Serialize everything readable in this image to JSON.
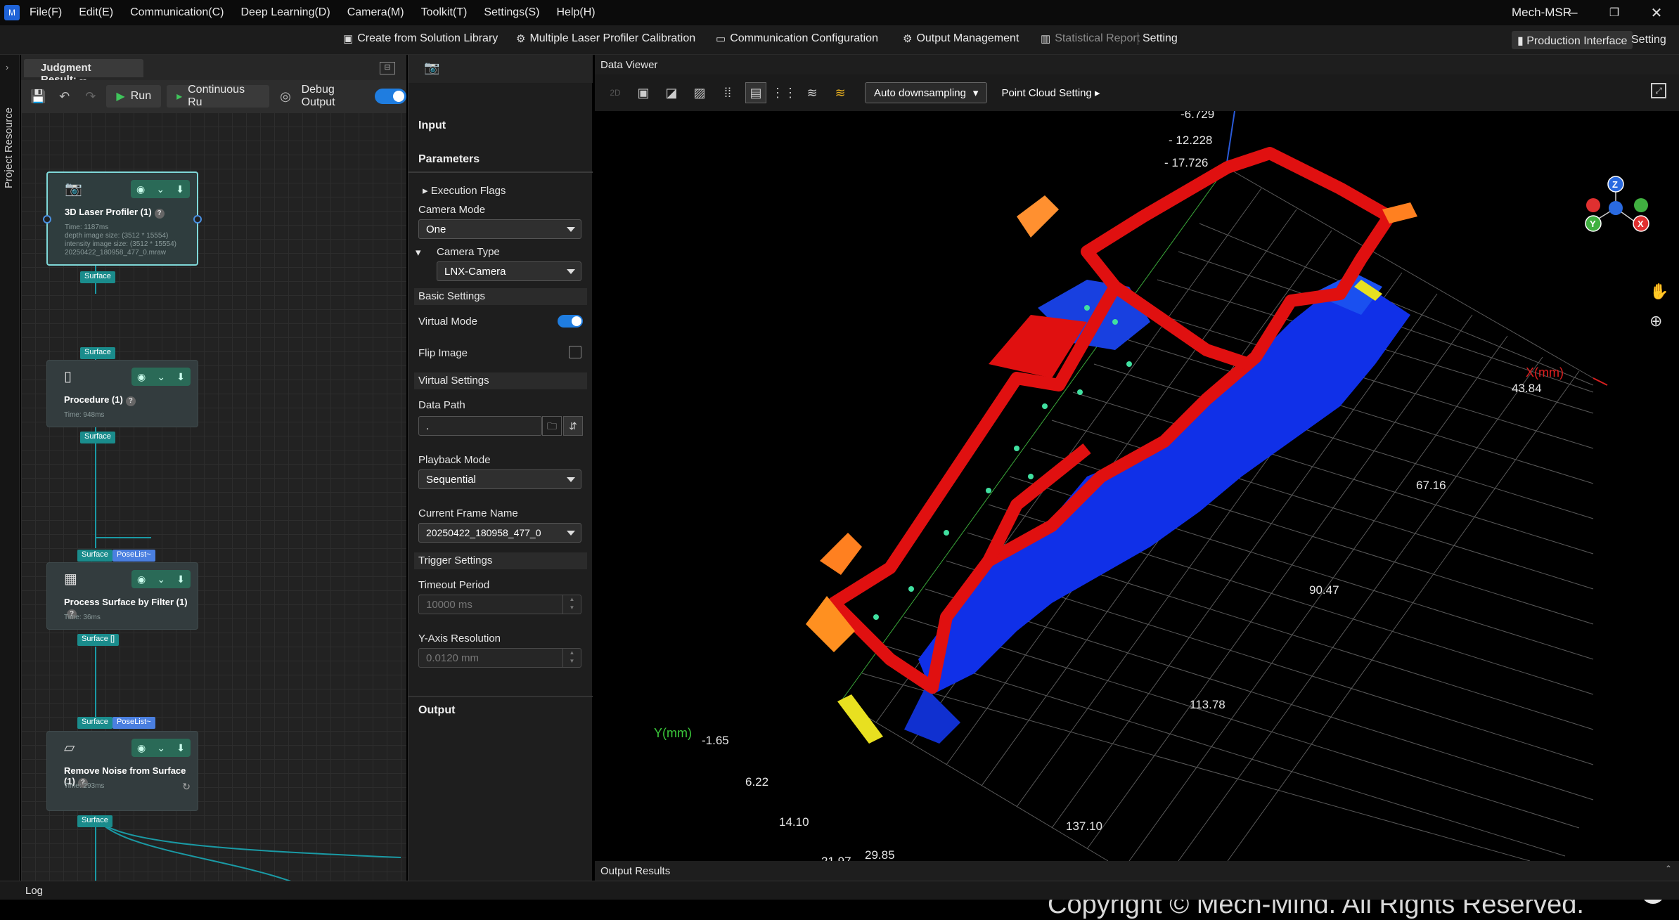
{
  "menubar": {
    "items": [
      "File(F)",
      "Edit(E)",
      "Communication(C)",
      "Deep Learning(D)",
      "Camera(M)",
      "Toolkit(T)",
      "Settings(S)",
      "Help(H)"
    ],
    "app_title": "Mech-MSR"
  },
  "toolbar": {
    "create_solution": "Create from Solution Library",
    "laser_calibration": "Multiple Laser Profiler Calibration",
    "communication_config": "Communication Configuration",
    "output_management": "Output Management",
    "statistical_report": "Statistical Report",
    "setting": "Setting",
    "production_interface": "Production Interface",
    "setting_right": "Setting"
  },
  "sidebar": {
    "label": "Project Resource"
  },
  "graph": {
    "tab_title": "Judgment Result: --",
    "run_label": "Run",
    "continuous_label": "Continuous Ru",
    "debug_label": "Debug Output",
    "nodes": [
      {
        "title": "3D Laser Profiler (1)",
        "info": [
          "Time: 1187ms",
          "depth image size: (3512 * 15554)",
          "intensity image size: (3512 * 15554)",
          "20250422_180958_477_0.mraw"
        ]
      },
      {
        "title": "Procedure (1)",
        "info": [
          "Time: 948ms"
        ]
      },
      {
        "title": "Process Surface by Filter (1)",
        "info": [
          "Time: 36ms"
        ]
      },
      {
        "title": "Remove Noise from Surface (1)",
        "info": [
          "Time: 293ms"
        ]
      }
    ],
    "ports": {
      "surface": "Surface",
      "poselist": "PoseList~",
      "surface_list": "Surface []"
    }
  },
  "params": {
    "input": "Input",
    "parameters": "Parameters",
    "execution_flags": "Execution Flags",
    "camera_mode_label": "Camera Mode",
    "camera_mode_value": "One",
    "camera_type_label": "Camera Type",
    "camera_type_value": "LNX-Camera",
    "basic_settings": "Basic Settings",
    "virtual_mode": "Virtual Mode",
    "flip_image": "Flip Image",
    "virtual_settings": "Virtual Settings",
    "data_path_label": "Data Path",
    "data_path_value": ".",
    "playback_mode_label": "Playback Mode",
    "playback_mode_value": "Sequential",
    "current_frame_label": "Current Frame Name",
    "current_frame_value": "20250422_180958_477_0",
    "trigger_settings": "Trigger Settings",
    "timeout_label": "Timeout Period",
    "timeout_value": "10000 ms",
    "y_res_label": "Y-Axis Resolution",
    "y_res_value": "0.0120 mm",
    "output": "Output"
  },
  "viewer": {
    "title": "Data Viewer",
    "downsample": "Auto downsampling",
    "point_cloud_setting": "Point Cloud Setting",
    "output_results": "Output Results",
    "copyright": "Copyright © Mech-Mind. All Rights Reserved.",
    "z_ticks": [
      "-6.729",
      "- 12.228",
      "- 17.726"
    ],
    "x_axis_label": "X(mm)",
    "x_ticks": [
      "43.84",
      "67.16",
      "90.47",
      "113.78",
      "137.10"
    ],
    "y_axis_label": "Y(mm)",
    "y_ticks": [
      "-1.65",
      "6.22",
      "14.10",
      "21.97",
      "29.85"
    ],
    "gizmo": {
      "z": "Z",
      "y": "Y",
      "x": "X"
    },
    "help": "?"
  },
  "log": {
    "label": "Log"
  },
  "colors": {
    "accent": "#1f7de0",
    "teal": "#1a8c8c",
    "red": "#e01010",
    "blue": "#1030e8"
  }
}
